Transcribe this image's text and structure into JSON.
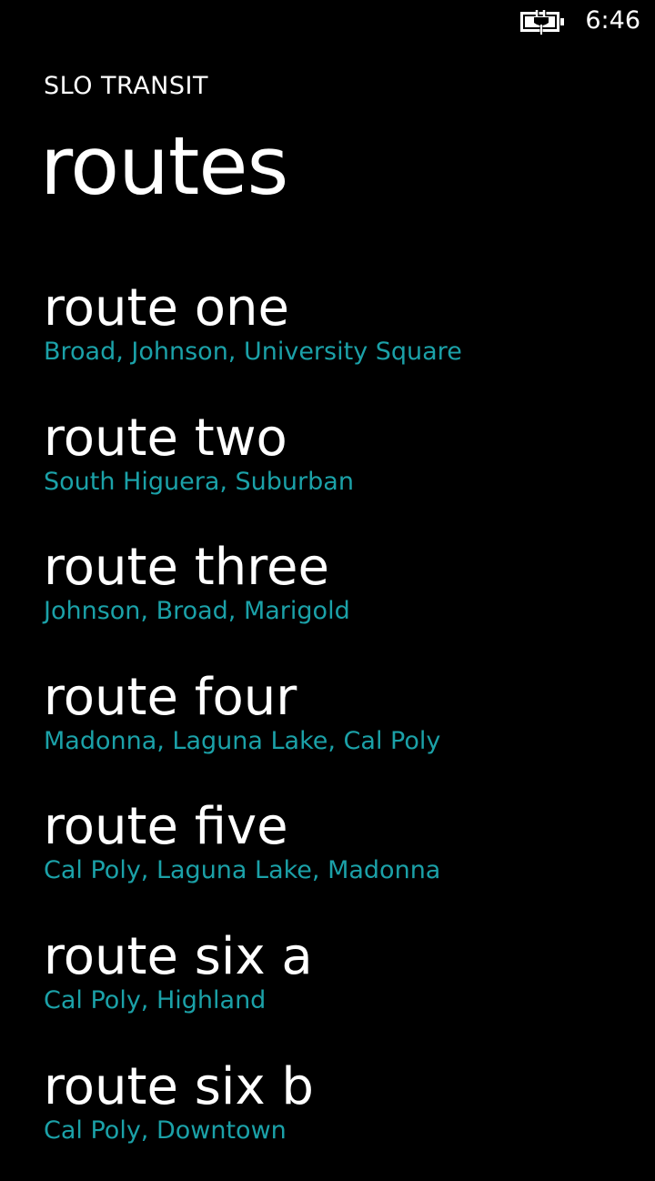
{
  "status_bar": {
    "battery_icon": "battery-charging-icon",
    "time": "6:46"
  },
  "header": {
    "app_title": "SLO TRANSIT",
    "page_title": "routes"
  },
  "colors": {
    "background": "#000000",
    "text": "#ffffff",
    "accent": "#1ba1a8"
  },
  "routes": [
    {
      "name": "route one",
      "stops": "Broad, Johnson, University Square"
    },
    {
      "name": "route two",
      "stops": "South Higuera, Suburban"
    },
    {
      "name": "route three",
      "stops": "Johnson, Broad, Marigold"
    },
    {
      "name": "route four",
      "stops": "Madonna, Laguna Lake, Cal Poly"
    },
    {
      "name": "route five",
      "stops": "Cal Poly, Laguna Lake, Madonna"
    },
    {
      "name": "route six a",
      "stops": "Cal Poly, Highland"
    },
    {
      "name": "route six b",
      "stops": "Cal Poly, Downtown"
    }
  ]
}
